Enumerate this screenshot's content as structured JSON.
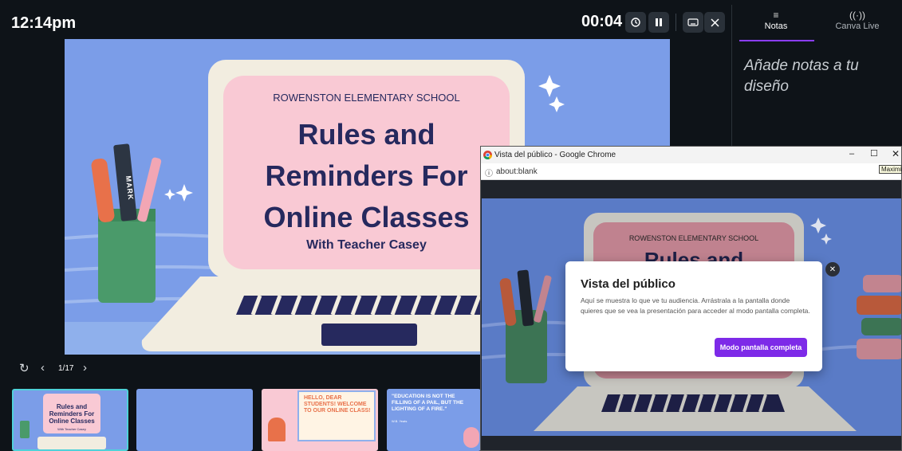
{
  "topbar": {
    "clock": "12:14pm",
    "timer": "00:04"
  },
  "panel": {
    "tabs": [
      {
        "label": "Notas",
        "icon": "notes-icon",
        "active": true
      },
      {
        "label": "Canva Live",
        "icon": "live-broadcast-icon",
        "active": false
      }
    ],
    "notes_placeholder": "Añade notas a tu diseño"
  },
  "slide": {
    "school": "ROWENSTON ELEMENTARY SCHOOL",
    "title": "Rules and Reminders For Online Classes",
    "subtitle": "With Teacher Casey",
    "marker_text": "MARK"
  },
  "controls": {
    "page": "1/17"
  },
  "thumbnails": [
    {
      "title": "Rules and Reminders For Online Classes",
      "subtitle": "With Teacher Casey"
    },
    {
      "title": ""
    },
    {
      "title": "HELLO, DEAR STUDENTS! WELCOME TO OUR ONLINE CLASS!"
    },
    {
      "title": "\"EDUCATION IS NOT THE FILLING OF A PAIL, BUT THE LIGHTING OF A FIRE.\"",
      "author": "W.B. Yeats"
    }
  ],
  "popup": {
    "window_title": "Vista del público - Google Chrome",
    "url": "about:blank",
    "tooltip": "Maximizar",
    "stage_school": "ROWENSTON ELEMENTARY SCHOOL",
    "stage_title_partial": "Rules and"
  },
  "dialog": {
    "title": "Vista del público",
    "body": "Aquí se muestra lo que ve tu audiencia. Arrástrala a la pantalla donde quieres que se vea la presentación para acceder al modo pantalla completa.",
    "button": "Modo pantalla completa"
  },
  "colors": {
    "accent": "#7d2ae8",
    "slide_bg": "#7b9de8",
    "card_pink": "#f9c9d4",
    "title_navy": "#26295e",
    "app_bg": "#0e1318"
  }
}
